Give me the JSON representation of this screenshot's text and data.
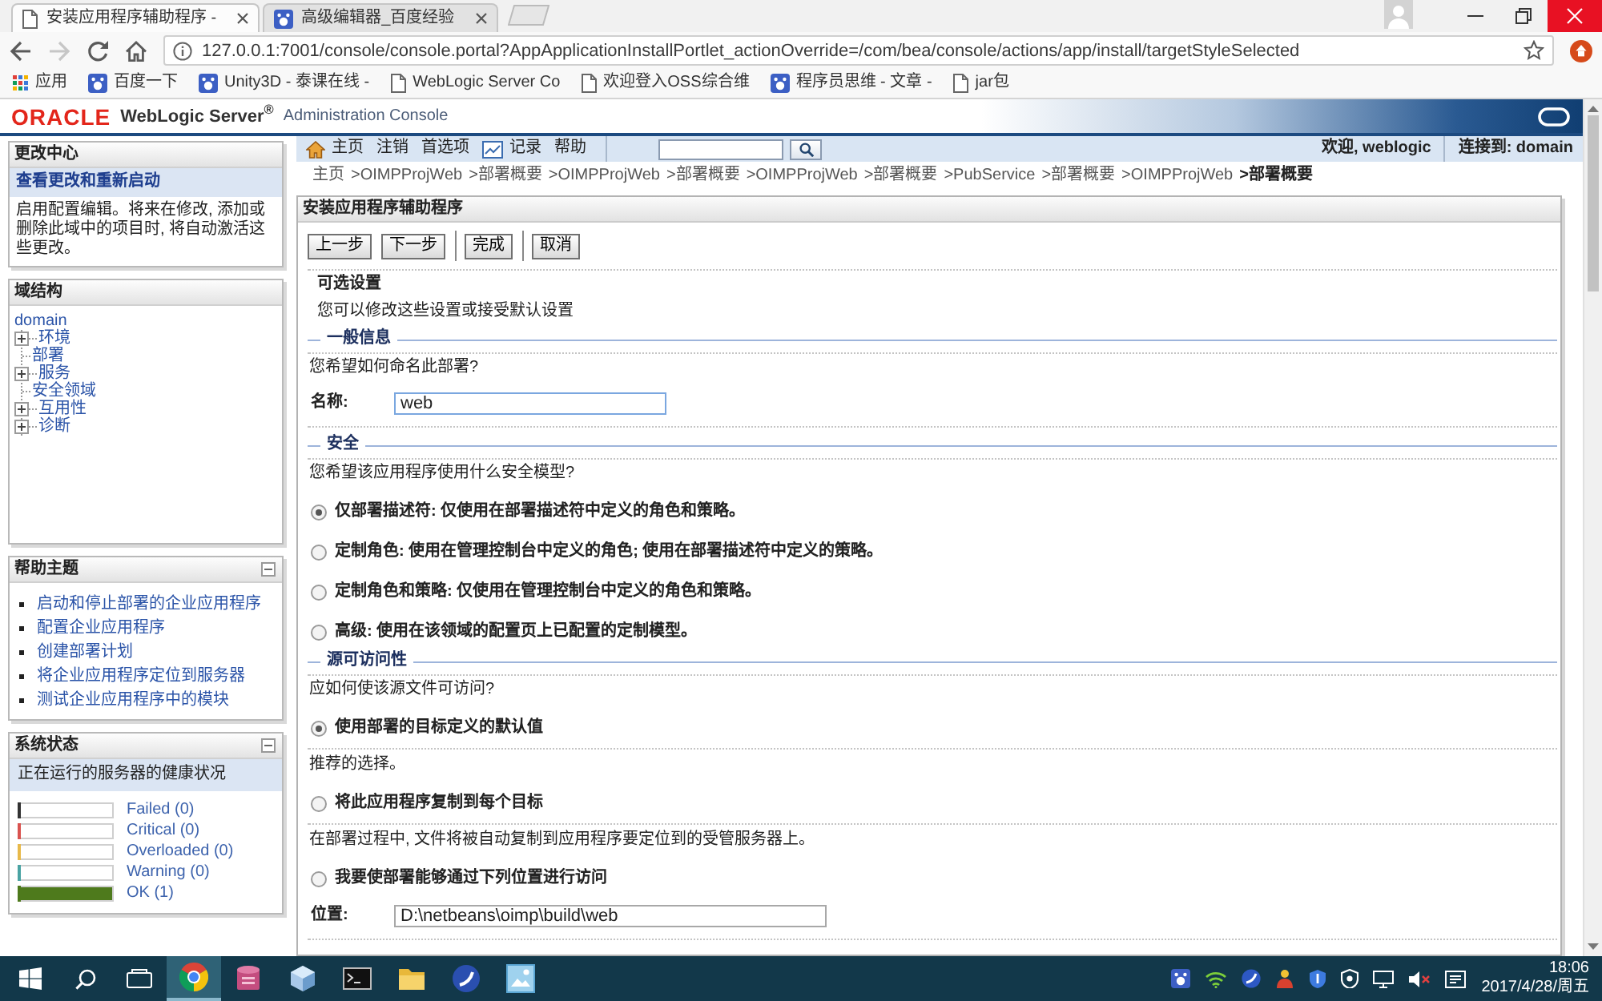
{
  "browser": {
    "tabs": [
      {
        "title": "安装应用程序辅助程序 -",
        "selected": true
      },
      {
        "title": "高级编辑器_百度经验",
        "selected": false
      }
    ],
    "nav_buttons": [
      {
        "kind": "back",
        "disabled": false
      },
      {
        "kind": "forward",
        "disabled": true
      },
      {
        "kind": "reload",
        "disabled": false
      },
      {
        "kind": "home",
        "disabled": false
      }
    ],
    "address": "127.0.0.1:7001/console/console.portal?AppApplicationInstallPortlet_actionOverride=/com/bea/console/actions/app/install/targetStyleSelected",
    "bookmarks": [
      {
        "label": "应用",
        "kind": "apps"
      },
      {
        "label": "百度一下",
        "kind": "site"
      },
      {
        "label": "Unity3D - 泰课在线 -",
        "kind": "site"
      },
      {
        "label": "WebLogic Server Co",
        "kind": "page"
      },
      {
        "label": "欢迎登入OSS综合维",
        "kind": "page"
      },
      {
        "label": "程序员思维 - 文章 -",
        "kind": "site"
      },
      {
        "label": "jar包",
        "kind": "page"
      }
    ]
  },
  "console_header": {
    "logo": "ORACLE",
    "product": "WebLogic Server$^{®}$",
    "subtitle": "Administration Console"
  },
  "change_center": {
    "title": "更改中心",
    "link": "查看更改和重新启动",
    "description": "启用配置编辑。将来在修改, 添加或删除此域中的项目时, 将自动激活这些更改。"
  },
  "domain_structure": {
    "title": "域结构",
    "tree": [
      {
        "label": "domain",
        "children": [
          {
            "label": "环境",
            "kind": "branch"
          },
          {
            "label": "部署",
            "kind": "leaf"
          },
          {
            "label": "服务",
            "kind": "branch"
          },
          {
            "label": "安全领域",
            "kind": "leaf"
          },
          {
            "label": "互用性",
            "kind": "branch"
          },
          {
            "label": "诊断",
            "kind": "branch"
          }
        ]
      }
    ]
  },
  "help_topics": {
    "title": "帮助主题",
    "links": [
      "启动和停止部署的企业应用程序",
      "配置企业应用程序",
      "创建部署计划",
      "将企业应用程序定位到服务器",
      "测试企业应用程序中的模块"
    ]
  },
  "system_status": {
    "title": "系统状态",
    "subtitle": "正在运行的服务器的健康状况",
    "servers": [
      {
        "label": "Failed (0)",
        "level": 0,
        "color": "#333333"
      },
      {
        "label": "Critical (0)",
        "level": 0,
        "color": "#d9534f"
      },
      {
        "label": "Overloaded (0)",
        "level": 0,
        "color": "#e8b94a"
      },
      {
        "label": "Warning (0)",
        "level": 0,
        "color": "#4aa3a3"
      },
      {
        "label": "OK (1)",
        "level": 1,
        "color": "#4e7a1c"
      }
    ]
  },
  "toolbar": {
    "links": [
      {
        "label": "主页",
        "kind": "home"
      },
      {
        "label": "注销",
        "kind": "text"
      },
      {
        "label": "首选项",
        "kind": "text"
      },
      {
        "label": "记录",
        "kind": "chart"
      },
      {
        "label": "帮助",
        "kind": "text"
      }
    ],
    "welcome": "欢迎, weblogic",
    "connection": "连接到: domain"
  },
  "breadcrumb": [
    {
      "label": "主页",
      "current": false
    },
    {
      "label": ">OIMPProjWeb",
      "current": false
    },
    {
      "label": ">部署概要",
      "current": false
    },
    {
      "label": ">OIMPProjWeb",
      "current": false
    },
    {
      "label": ">部署概要",
      "current": false
    },
    {
      "label": ">OIMPProjWeb",
      "current": false
    },
    {
      "label": ">部署概要",
      "current": false
    },
    {
      "label": ">PubService",
      "current": false
    },
    {
      "label": ">部署概要",
      "current": false
    },
    {
      "label": ">OIMPProjWeb",
      "current": false
    },
    {
      "label": ">部署概要",
      "current": true
    }
  ],
  "assistant": {
    "title": "安装应用程序辅助程序",
    "button_groups": [
      [
        "上一步",
        "下一步"
      ],
      [
        "完成"
      ],
      [
        "取消"
      ]
    ],
    "heading": "可选设置",
    "intro": "您可以修改这些设置或接受默认设置",
    "sections": [
      {
        "legend": "一般信息",
        "question": "您希望如何命名此部署?",
        "items": [
          {
            "kind": "field",
            "label": "名称:",
            "value": "web",
            "focused": true
          }
        ]
      },
      {
        "legend": "安全",
        "question": "您希望该应用程序使用什么安全模型?",
        "items": [
          {
            "kind": "radio",
            "label": "仅部署描述符: 仅使用在部署描述符中定义的角色和策略。",
            "selected": true
          },
          {
            "kind": "radio",
            "label": "定制角色: 使用在管理控制台中定义的角色; 使用在部署描述符中定义的策略。",
            "selected": false
          },
          {
            "kind": "radio",
            "label": "定制角色和策略: 仅使用在管理控制台中定义的角色和策略。",
            "selected": false
          },
          {
            "kind": "radio",
            "label": "高级: 使用在该领域的配置页上已配置的定制模型。",
            "selected": false
          }
        ]
      },
      {
        "legend": "源可访问性",
        "question": "应如何使该源文件可访问?",
        "items": [
          {
            "kind": "radio",
            "label": "使用部署的目标定义的默认值",
            "selected": true
          },
          {
            "kind": "note",
            "text": "推荐的选择。"
          },
          {
            "kind": "radio",
            "label": "将此应用程序复制到每个目标",
            "selected": false
          },
          {
            "kind": "note",
            "text": "在部署过程中, 文件将被自动复制到应用程序要定位到的受管服务器上。"
          },
          {
            "kind": "radio",
            "label": "我要使部署能够通过下列位置进行访问",
            "selected": false
          },
          {
            "kind": "field",
            "label": "位置:",
            "value": "D:\\netbeans\\oimp\\build\\web",
            "focused": false
          }
        ]
      }
    ]
  },
  "taskbar": {
    "apps": [
      {
        "kind": "browser",
        "selected": true
      },
      {
        "kind": "database",
        "selected": false
      },
      {
        "kind": "cube",
        "selected": false
      },
      {
        "kind": "terminal",
        "selected": false
      },
      {
        "kind": "folder",
        "selected": false
      },
      {
        "kind": "circle",
        "selected": false
      },
      {
        "kind": "tile",
        "selected": false
      }
    ],
    "time": "18:06",
    "date": "2017/4/28/周五"
  }
}
